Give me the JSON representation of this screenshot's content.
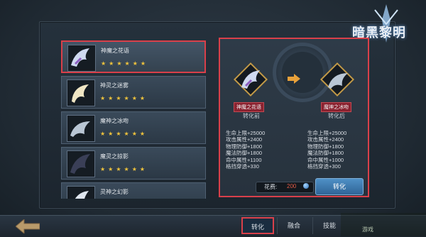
{
  "logo": {
    "text": "暗黑黎明"
  },
  "list": {
    "items": [
      {
        "name": "神魔之花语",
        "stars": "★★★★★★",
        "selected": true
      },
      {
        "name": "神灵之迷雾",
        "stars": "★★★★★★",
        "selected": false
      },
      {
        "name": "魔神之冰吻",
        "stars": "★★★★★★",
        "selected": false
      },
      {
        "name": "魔灵之掠影",
        "stars": "★★★★★★",
        "selected": false
      },
      {
        "name": "灵神之幻影",
        "stars": "",
        "selected": false
      }
    ]
  },
  "transform": {
    "left": {
      "name": "神魔之花语",
      "sub": "转化前",
      "stats": [
        "生命上限+25000",
        "攻击属性+2400",
        "物理防御+1800",
        "魔法防御+1800",
        "命中属性+1100",
        "格挡穿透+330"
      ]
    },
    "right": {
      "name": "魔神之冰吻",
      "sub": "转化后",
      "stats": [
        "生命上限+25000",
        "攻击属性+2400",
        "物理防御+1800",
        "魔法防御+1800",
        "命中属性+1000",
        "格挡穿透+300"
      ]
    },
    "cost_label": "花费:",
    "cost_value": "200",
    "convert_label": "转化"
  },
  "bottom": {
    "tabs": [
      {
        "label": "转化",
        "active": true
      },
      {
        "label": "融合",
        "active": false
      },
      {
        "label": "技能",
        "active": false
      }
    ],
    "watermark": "游戏"
  },
  "colors": {
    "accent_red": "#d9404a",
    "star": "#f0c33c",
    "button_blue": "#3f7db2",
    "cost": "#e15a46"
  }
}
